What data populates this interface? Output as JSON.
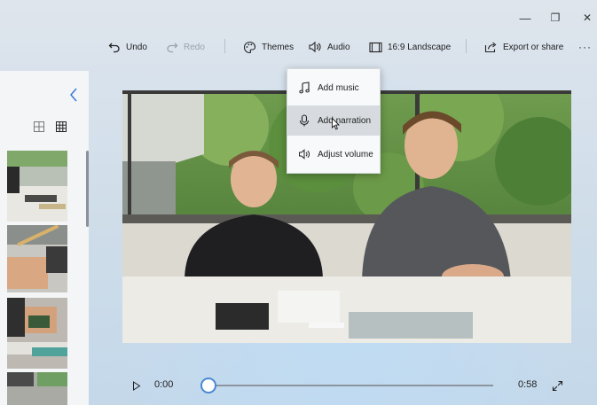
{
  "window": {
    "minimize_glyph": "—",
    "restore_glyph": "❐",
    "close_glyph": "✕"
  },
  "toolbar": {
    "undo_label": "Undo",
    "redo_label": "Redo",
    "themes_label": "Themes",
    "audio_label": "Audio",
    "aspect_label": "16:9 Landscape",
    "export_label": "Export or share",
    "more_label": "···"
  },
  "audio_menu": {
    "items": [
      {
        "label": "Add music",
        "icon": "music-note-icon"
      },
      {
        "label": "Add narration",
        "icon": "microphone-icon"
      },
      {
        "label": "Adjust volume",
        "icon": "volume-icon"
      }
    ],
    "hovered_index": 1
  },
  "left_panel": {
    "view_modes": [
      "grid-large-icon",
      "grid-small-icon"
    ],
    "selected_view": "grid-small-icon"
  },
  "player": {
    "current_time": "0:00",
    "duration": "0:58",
    "progress": 0
  },
  "colors": {
    "accent": "#4a88d4",
    "menu_hover": "#d7dbdf"
  }
}
